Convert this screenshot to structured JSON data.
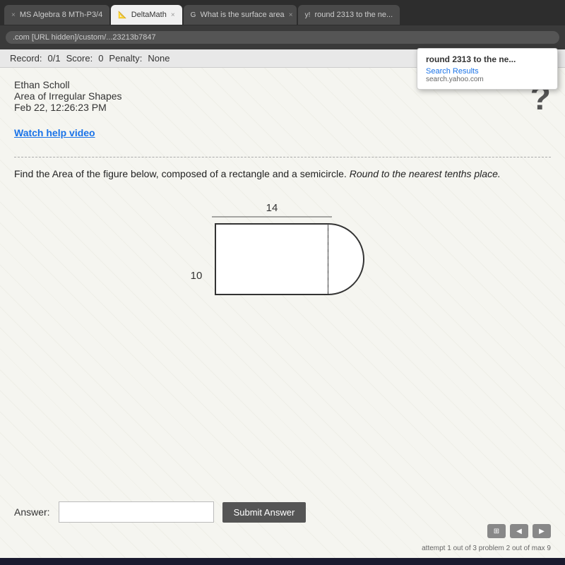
{
  "browser": {
    "tabs": [
      {
        "label": "MS Algebra 8 MTh-P3/4",
        "active": false,
        "favicon": "×"
      },
      {
        "label": "DeltaMath",
        "active": true,
        "favicon": "📐"
      },
      {
        "label": "What is the surface area",
        "active": false,
        "favicon": "G"
      },
      {
        "label": "round 2313 to the ne...",
        "active": false,
        "favicon": "y!"
      }
    ],
    "address": ".com   [URL hidden]/custom/...23213b7847"
  },
  "dropdown": {
    "title": "round 2313 to the ne...",
    "subtitle": "Search Results",
    "source": "search.yahoo.com"
  },
  "record_bar": {
    "label": "Record:",
    "record_value": "0/1",
    "score_label": "Score:",
    "score_value": "0",
    "penalty_label": "Penalty:",
    "penalty_value": "None"
  },
  "content": {
    "user_name": "Ethan Scholl",
    "subject": "Area of Irregular Shapes",
    "datetime": "Feb 22, 12:26:23 PM",
    "help_link": "Watch help video",
    "question_mark": "?",
    "problem_text": "Find the Area of the figure below, composed of a rectangle and a semicircle.",
    "problem_italic": "Round to the nearest tenths place.",
    "figure": {
      "width_label": "14",
      "height_label": "10"
    },
    "answer_label": "Answer:",
    "answer_placeholder": "",
    "submit_button": "Submit Answer",
    "attempt_text": "attempt 1 out of 3   problem 2 out of max 9"
  }
}
